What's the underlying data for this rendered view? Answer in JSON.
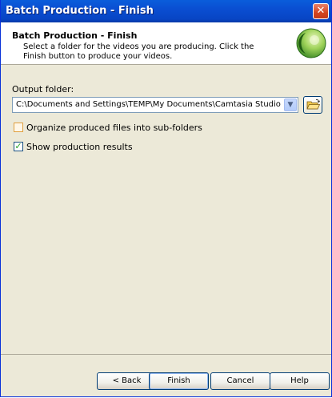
{
  "window": {
    "title": "Batch Production - Finish"
  },
  "header": {
    "title": "Batch Production - Finish",
    "description": "Select a folder for the videos you are producing.  Click the Finish button to produce your videos."
  },
  "output": {
    "label": "Output folder:",
    "folder_value": "C:\\Documents and Settings\\TEMP\\My Documents\\Camtasia Studio"
  },
  "options": {
    "organize_subfolders": {
      "label": "Organize produced files into sub-folders",
      "checked": false
    },
    "show_results": {
      "label": "Show production results",
      "checked": true
    }
  },
  "buttons": {
    "back": "< Back",
    "finish": "Finish",
    "cancel": "Cancel",
    "help": "Help"
  },
  "icons": {
    "close": "close-icon",
    "logo": "camtasia-logo-icon",
    "browse": "folder-open-icon",
    "dropdown": "chevron-down-icon",
    "checkmark": "checkmark-icon"
  },
  "colors": {
    "titlebar": "#0a4ed2",
    "close_button": "#d44420",
    "logo_green": "#3a9a2a"
  }
}
